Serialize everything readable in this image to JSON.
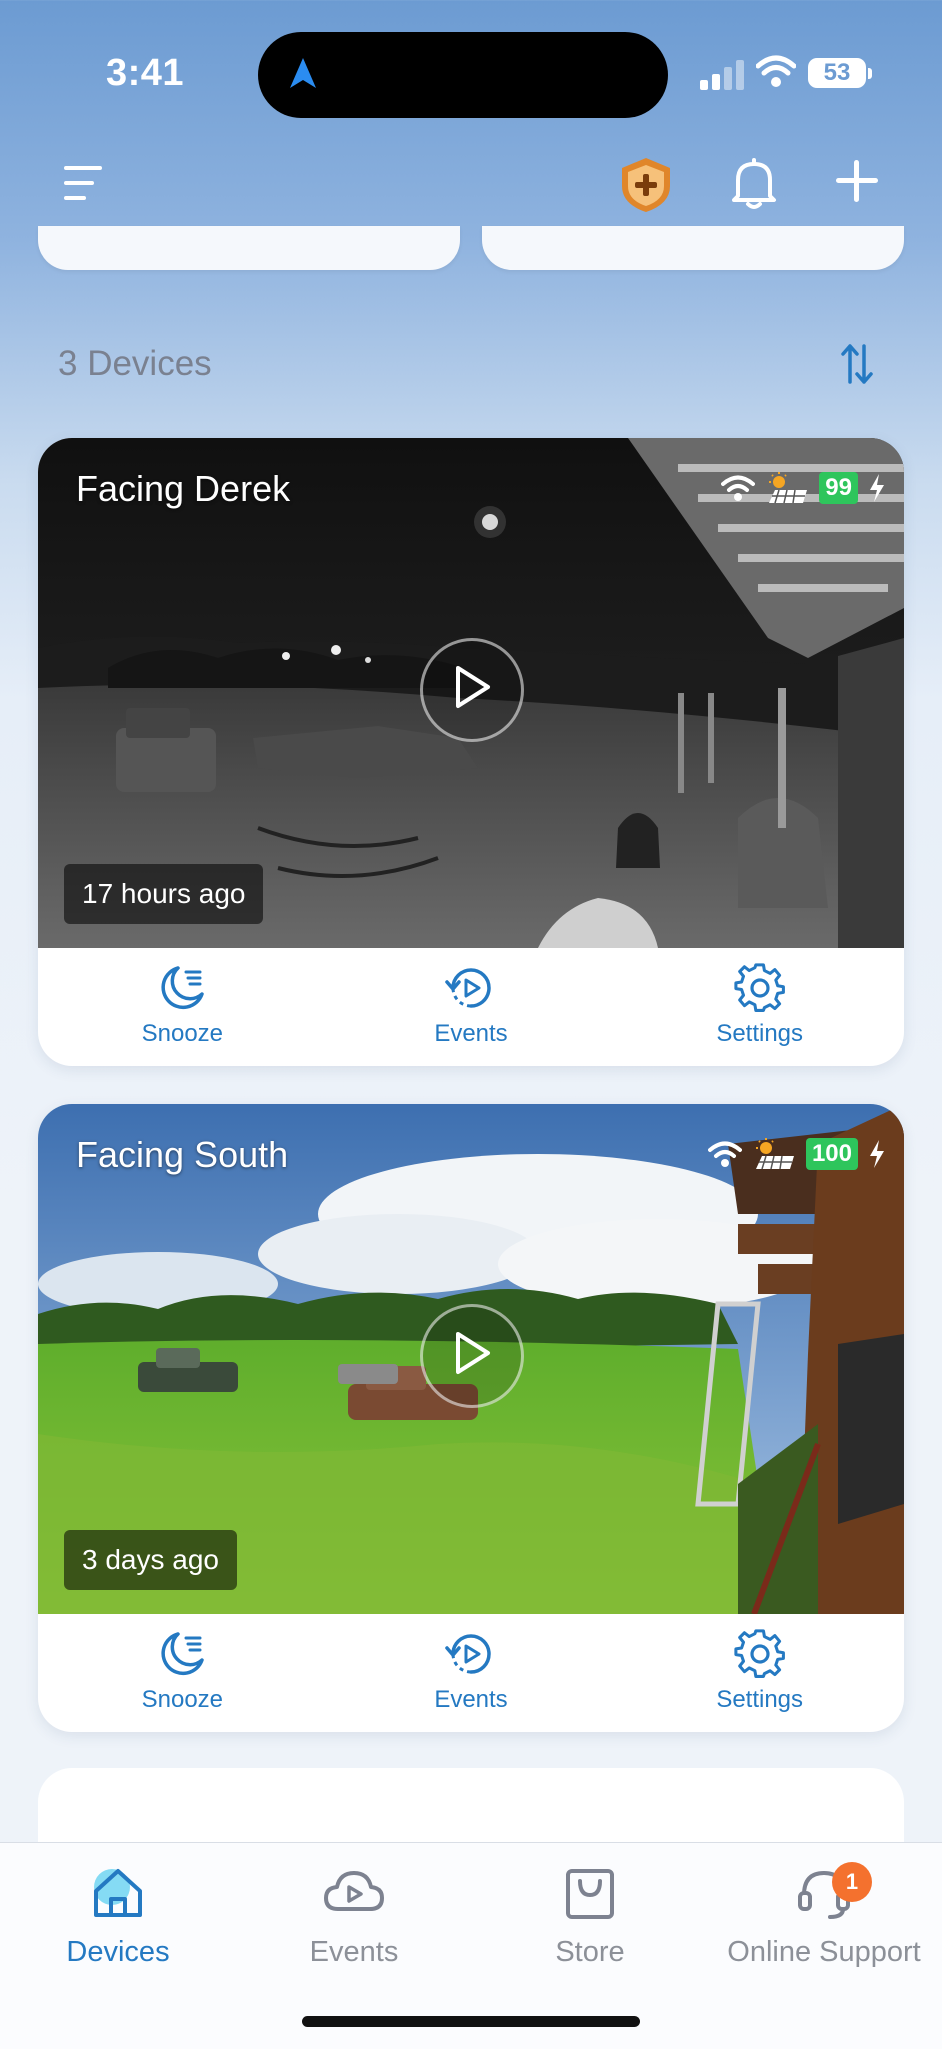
{
  "status_bar": {
    "time": "3:41",
    "battery": "53"
  },
  "header": {
    "menu_icon": "menu-icon",
    "shield_icon": "shield-plus-icon",
    "bell_icon": "bell-icon",
    "add_icon": "plus-icon"
  },
  "devices_header": {
    "count_label": "3 Devices",
    "sort_icon": "sort-icon"
  },
  "devices": [
    {
      "name": "Facing Derek",
      "battery": "99",
      "last_seen": "17 hours ago",
      "actions": [
        "Snooze",
        "Events",
        "Settings"
      ]
    },
    {
      "name": "Facing South",
      "battery": "100",
      "last_seen": "3 days ago",
      "actions": [
        "Snooze",
        "Events",
        "Settings"
      ]
    }
  ],
  "tabs": [
    {
      "label": "Devices",
      "icon": "home-icon",
      "active": true
    },
    {
      "label": "Events",
      "icon": "cloud-play-icon",
      "active": false
    },
    {
      "label": "Store",
      "icon": "shopping-bag-icon",
      "active": false
    },
    {
      "label": "Online Support",
      "icon": "headset-icon",
      "active": false
    }
  ],
  "support_badge": "1",
  "colors": {
    "accent": "#2479c2",
    "battery_green": "#2ec55c",
    "badge_orange": "#f4712e",
    "shield_orange": "#e0862a"
  }
}
